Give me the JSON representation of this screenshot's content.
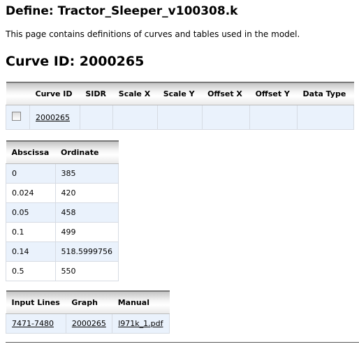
{
  "title": "Define: Tractor_Sleeper_v100308.k",
  "description": "This page contains definitions of curves and tables used in the model.",
  "curve_heading": "Curve ID: 2000265",
  "curve_table": {
    "headers": [
      "",
      "Curve ID",
      "SIDR",
      "Scale X",
      "Scale Y",
      "Offset X",
      "Offset Y",
      "Data Type"
    ],
    "row": {
      "checked": false,
      "curve_id": "2000265",
      "sidr": "",
      "scale_x": "",
      "scale_y": "",
      "offset_x": "",
      "offset_y": "",
      "data_type": ""
    }
  },
  "points_table": {
    "headers": [
      "Abscissa",
      "Ordinate"
    ],
    "rows": [
      [
        "0",
        "385"
      ],
      [
        "0.024",
        "420"
      ],
      [
        "0.05",
        "458"
      ],
      [
        "0.1",
        "499"
      ],
      [
        "0.14",
        "518.5999756"
      ],
      [
        "0.5",
        "550"
      ]
    ]
  },
  "links_table": {
    "headers": [
      "Input Lines",
      "Graph",
      "Manual"
    ],
    "row": [
      "7471-7480",
      "2000265",
      "l971k_1.pdf"
    ]
  }
}
